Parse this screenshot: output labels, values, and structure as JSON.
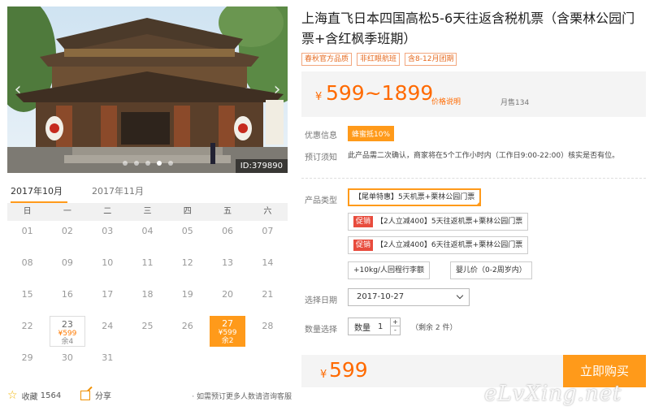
{
  "gallery": {
    "photo_id": "ID:379890",
    "dot_count": 5,
    "active_dot": 3
  },
  "calendar": {
    "tabs": [
      "2017年10月",
      "2017年11月"
    ],
    "active_tab": 0,
    "weekdays": [
      "日",
      "一",
      "二",
      "三",
      "四",
      "五",
      "六"
    ],
    "weeks": [
      [
        {
          "d": "01"
        },
        {
          "d": "02"
        },
        {
          "d": "03"
        },
        {
          "d": "04"
        },
        {
          "d": "05"
        },
        {
          "d": "06"
        },
        {
          "d": "07"
        }
      ],
      [
        {
          "d": "08"
        },
        {
          "d": "09"
        },
        {
          "d": "10"
        },
        {
          "d": "11"
        },
        {
          "d": "12"
        },
        {
          "d": "13"
        },
        {
          "d": "14"
        }
      ],
      [
        {
          "d": "15"
        },
        {
          "d": "16"
        },
        {
          "d": "17"
        },
        {
          "d": "18"
        },
        {
          "d": "19"
        },
        {
          "d": "20"
        },
        {
          "d": "21"
        }
      ],
      [
        {
          "d": "22"
        },
        {
          "d": "23",
          "price": "¥599",
          "stock": "余4",
          "state": "avail"
        },
        {
          "d": "24"
        },
        {
          "d": "25"
        },
        {
          "d": "26"
        },
        {
          "d": "27",
          "price": "¥599",
          "stock": "余2",
          "state": "sel"
        },
        {
          "d": "28"
        }
      ],
      [
        {
          "d": "29"
        },
        {
          "d": "30"
        },
        {
          "d": "31"
        },
        {
          "d": ""
        },
        {
          "d": ""
        },
        {
          "d": ""
        },
        {
          "d": ""
        }
      ]
    ]
  },
  "actions": {
    "favorite_label": "收藏",
    "favorite_count": "1564",
    "share_label": "分享",
    "tip": "· 如需预订更多人数请咨询客服"
  },
  "product": {
    "title": "上海直飞日本四国高松5-6天往返含税机票（含栗林公园门票+含红枫季班期）",
    "tags": [
      "春秋官方品质",
      "非红眼航班",
      "含8-12月团期"
    ],
    "currency": "¥",
    "price_range": "599~1899",
    "price_explain": "价格说明",
    "monthly_sales": "月售134"
  },
  "info": {
    "promo_label": "优惠信息",
    "promo_badge": "蜂蜜抵10%",
    "notice_label": "预订须知",
    "notice_text": "此产品需二次确认，商家将在5个工作小时内（工作日9:00-22:00）核实是否有位。"
  },
  "options": {
    "label": "产品类型",
    "items": [
      {
        "badge": "",
        "text": "【尾单特惠】5天机票+栗林公园门票",
        "selected": true
      },
      {
        "badge": "促销",
        "text": "【2人立减400】5天往返机票+栗林公园门票",
        "selected": false
      },
      {
        "badge": "促销",
        "text": "【2人立减400】6天往返机票+栗林公园门票",
        "selected": false
      },
      {
        "badge": "",
        "text": "+10kg/人回程行李额",
        "selected": false
      },
      {
        "badge": "",
        "text": "婴儿价（0-2周岁内）",
        "selected": false
      }
    ]
  },
  "booking": {
    "date_label": "选择日期",
    "date_value": "2017-10-27",
    "qty_label": "数量选择",
    "qty_prefix": "数量",
    "qty_value": "1",
    "qty_plus": "+",
    "qty_minus": "-",
    "remain": "（剩余 2 件）",
    "final_currency": "¥",
    "final_price": "599",
    "buy_label": "立即购买"
  },
  "watermark": "eLvXing.net",
  "colors": {
    "accent": "#ff9a1a",
    "price": "#ff6a00",
    "promo_red": "#e84c3d"
  }
}
